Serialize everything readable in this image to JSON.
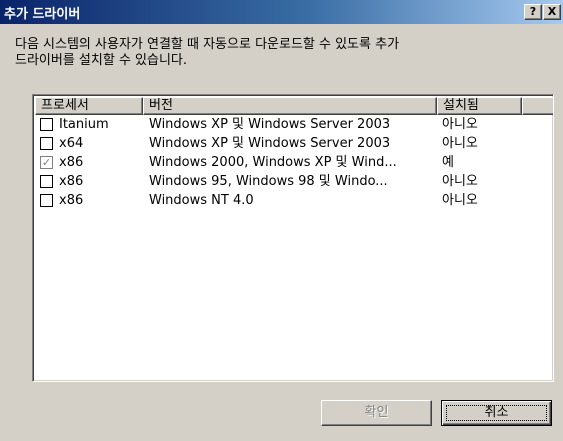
{
  "window": {
    "title": "추가 드라이버",
    "help_label": "?",
    "close_label": "X"
  },
  "description": "다음 시스템의 사용자가 연결할 때 자동으로 다운로드할 수 있도록 추가\n드라이버를 설치할 수 있습니다.",
  "list": {
    "columns": {
      "processor": "프로세서",
      "version": "버전",
      "installed": "설치됨"
    },
    "rows": [
      {
        "processor": "Itanium",
        "version": "Windows XP 및 Windows Server 2003",
        "installed": "아니오",
        "checked": false,
        "disabled": false
      },
      {
        "processor": "x64",
        "version": "Windows XP 및 Windows Server 2003",
        "installed": "아니오",
        "checked": false,
        "disabled": false
      },
      {
        "processor": "x86",
        "version": "Windows 2000, Windows XP 및 Wind...",
        "installed": "예",
        "checked": true,
        "disabled": true
      },
      {
        "processor": "x86",
        "version": "Windows 95, Windows 98 및 Windo...",
        "installed": "아니오",
        "checked": false,
        "disabled": false
      },
      {
        "processor": "x86",
        "version": "Windows NT 4.0",
        "installed": "아니오",
        "checked": false,
        "disabled": false
      }
    ]
  },
  "buttons": {
    "ok": "확인",
    "cancel": "취소"
  },
  "colors": {
    "title_gradient_start": "#0a246a",
    "title_gradient_end": "#a6caf0",
    "dialog_face": "#d4d0c8"
  }
}
